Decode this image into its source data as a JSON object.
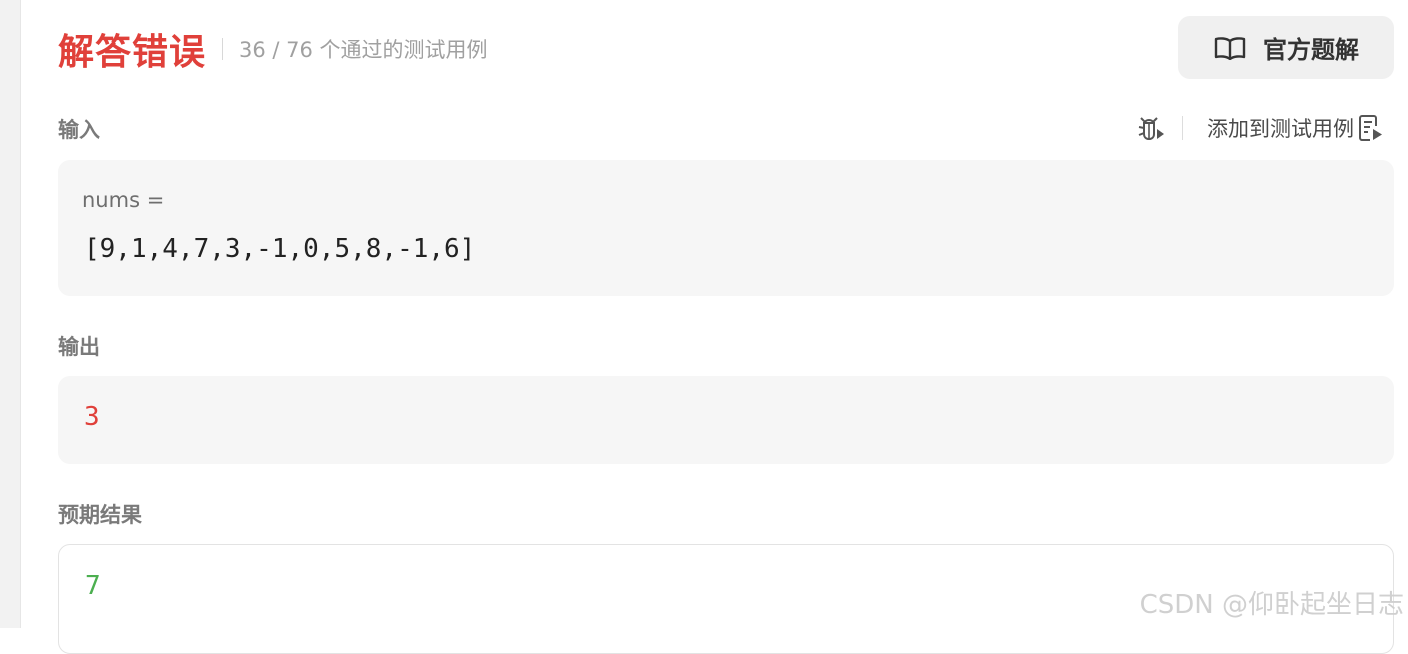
{
  "result": {
    "title": "解答错误",
    "case_count": "36 / 76 个通过的测试用例"
  },
  "solution_button": {
    "label": "官方题解",
    "icon": "book-open-icon"
  },
  "input": {
    "label": "输入",
    "param_name": "nums =",
    "value": "[9,1,4,7,3,-1,0,5,8,-1,6]",
    "debug_icon": "debug-bug-icon",
    "add_case_label": "添加到测试用例",
    "add_case_icon": "add-testcase-icon"
  },
  "output": {
    "label": "输出",
    "value": "3"
  },
  "expected": {
    "label": "预期结果",
    "value": "7"
  },
  "watermark": "CSDN @仰卧起坐日志",
  "colors": {
    "error_red": "#e0403a",
    "output_red": "#e0403a",
    "expected_green": "#4caf50"
  }
}
